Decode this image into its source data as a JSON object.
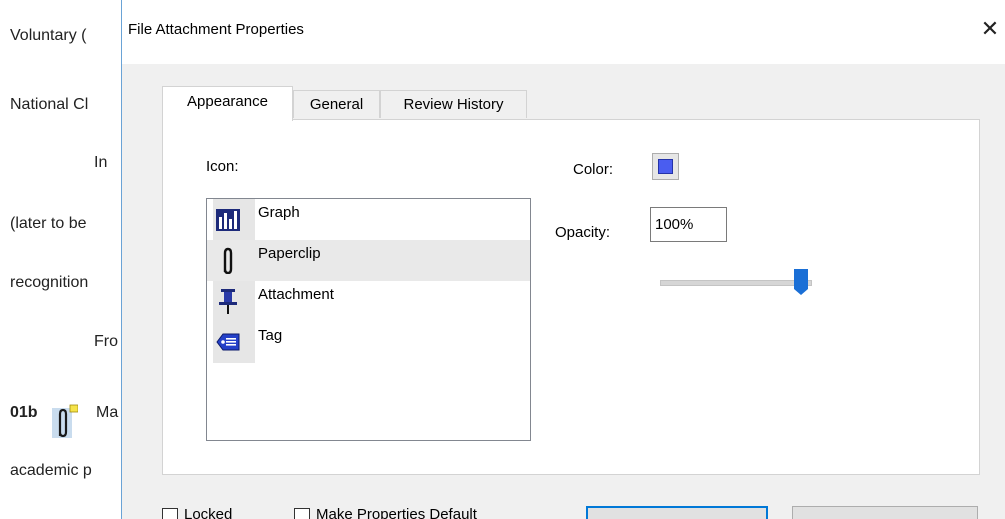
{
  "document": {
    "lines": [
      "Voluntary (",
      "National Cl",
      "In",
      "(later to be",
      "recognition",
      "Fro",
      "01b",
      "Ma",
      "academic p"
    ]
  },
  "dialog": {
    "title": "File Attachment Properties",
    "close_glyph": "✕",
    "tabs": [
      {
        "label": "Appearance",
        "active": true
      },
      {
        "label": "General",
        "active": false
      },
      {
        "label": "Review History",
        "active": false
      }
    ],
    "appearance": {
      "icon_label": "Icon:",
      "icons": [
        {
          "label": "Graph",
          "icon": "graph-icon",
          "selected": false
        },
        {
          "label": "Paperclip",
          "icon": "paperclip-icon",
          "selected": true
        },
        {
          "label": "Attachment",
          "icon": "pushpin-icon",
          "selected": false
        },
        {
          "label": "Tag",
          "icon": "tag-icon",
          "selected": false
        }
      ],
      "color_label": "Color:",
      "color_value": "#4a5df0",
      "opacity_label": "Opacity:",
      "opacity_value": "100%",
      "opacity_fraction": 1.0
    },
    "footer": {
      "locked_label": "Locked",
      "make_default_label": "Make Properties Default"
    }
  }
}
